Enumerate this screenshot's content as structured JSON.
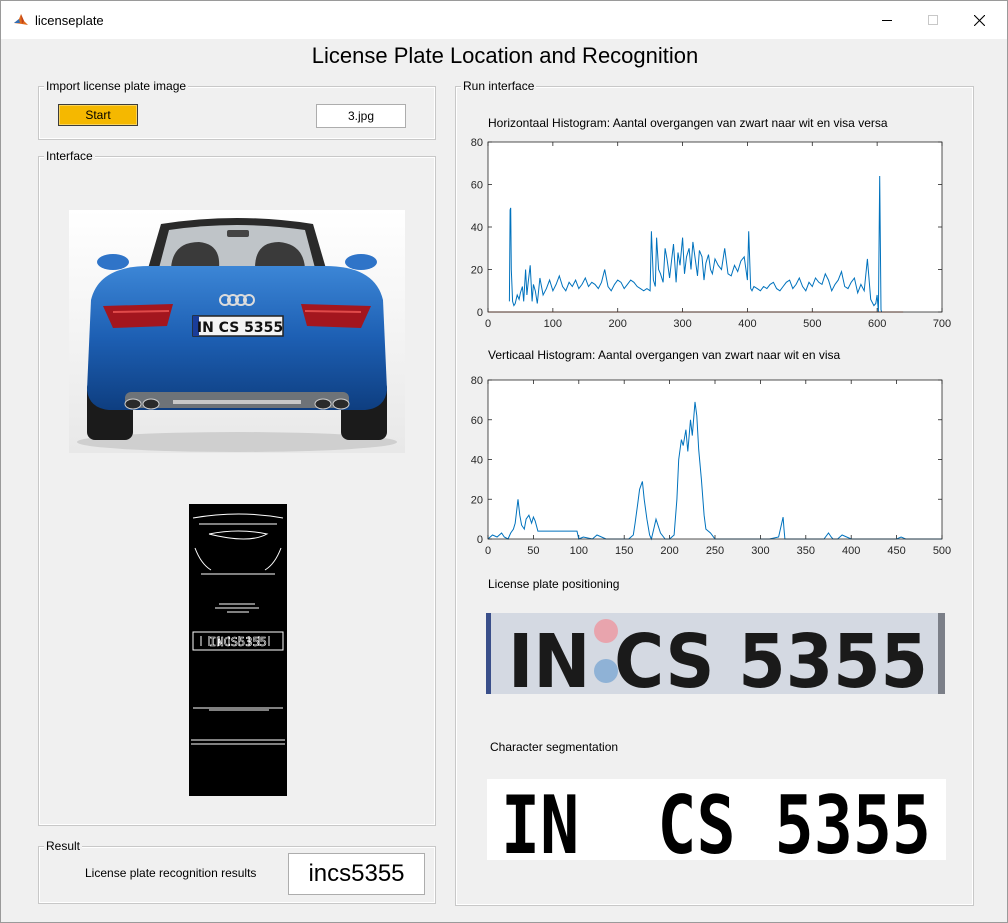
{
  "window": {
    "title": "licenseplate",
    "controls": [
      "minimize-icon",
      "maximize-icon",
      "close-icon"
    ]
  },
  "app_title": "License Plate Location and Recognition",
  "import_panel": {
    "legend": "Import license plate image",
    "start_label": "Start",
    "filename": "3.jpg"
  },
  "interface_panel": {
    "legend": "Interface",
    "car_plate_text": "IN CS 5355",
    "edge_plate_text": "INCS5355"
  },
  "result_panel": {
    "legend": "Result",
    "label": "License plate recognition results",
    "value": "incs5355"
  },
  "run_panel": {
    "legend": "Run interface",
    "plate_positioning_title": "License plate positioning",
    "plate_crop_text": "IN CS 5355",
    "segmentation_title": "Character segmentation",
    "segmentation_text": "IN  CS 5355"
  },
  "chart_data": [
    {
      "type": "line",
      "title": "Horizontaal Histogram: Aantal overgangen van zwart naar wit en visa versa",
      "xlim": [
        0,
        700
      ],
      "ylim": [
        0,
        80
      ],
      "xticks": [
        0,
        100,
        200,
        300,
        400,
        500,
        600,
        700
      ],
      "yticks": [
        0,
        20,
        40,
        60,
        80
      ],
      "series": [
        {
          "color": "#0072bd",
          "x": [
            33,
            34,
            35,
            36,
            38,
            40,
            42,
            45,
            48,
            50,
            53,
            55,
            58,
            60,
            62,
            65,
            68,
            70,
            73,
            76,
            80,
            85,
            90,
            95,
            100,
            105,
            110,
            115,
            120,
            125,
            130,
            135,
            140,
            145,
            150,
            155,
            160,
            165,
            170,
            175,
            180,
            185,
            190,
            195,
            200,
            205,
            210,
            215,
            220,
            225,
            230,
            235,
            240,
            245,
            250,
            252,
            255,
            258,
            260,
            263,
            266,
            270,
            273,
            276,
            280,
            283,
            286,
            290,
            293,
            296,
            300,
            303,
            306,
            310,
            313,
            316,
            320,
            323,
            326,
            330,
            333,
            336,
            340,
            343,
            346,
            350,
            355,
            360,
            365,
            370,
            375,
            380,
            385,
            390,
            395,
            400,
            402,
            405,
            407,
            410,
            415,
            420,
            425,
            430,
            435,
            440,
            445,
            450,
            455,
            460,
            465,
            470,
            475,
            480,
            485,
            490,
            495,
            500,
            505,
            510,
            515,
            520,
            525,
            530,
            535,
            540,
            545,
            550,
            555,
            560,
            565,
            570,
            575,
            580,
            585,
            590,
            595,
            598,
            600,
            602,
            604,
            605,
            606,
            607,
            610,
            620,
            640
          ],
          "y": [
            5,
            48,
            49,
            20,
            5,
            3,
            4,
            8,
            6,
            9,
            12,
            5,
            20,
            8,
            14,
            22,
            5,
            13,
            10,
            4,
            16,
            8,
            11,
            15,
            10,
            13,
            17,
            12,
            10,
            14,
            12,
            15,
            11,
            13,
            16,
            12,
            14,
            13,
            11,
            14,
            20,
            12,
            10,
            13,
            15,
            14,
            11,
            13,
            15,
            14,
            12,
            11,
            10,
            11,
            10,
            38,
            15,
            12,
            35,
            20,
            18,
            14,
            30,
            25,
            16,
            24,
            32,
            14,
            28,
            22,
            35,
            18,
            26,
            30,
            20,
            33,
            24,
            17,
            29,
            26,
            15,
            23,
            27,
            20,
            18,
            25,
            22,
            20,
            30,
            18,
            17,
            22,
            19,
            24,
            26,
            15,
            38,
            11,
            10,
            12,
            11,
            10,
            12,
            11,
            13,
            14,
            11,
            10,
            12,
            14,
            15,
            11,
            13,
            16,
            12,
            10,
            14,
            12,
            16,
            14,
            13,
            18,
            15,
            10,
            13,
            15,
            19,
            12,
            11,
            14,
            16,
            9,
            13,
            10,
            25,
            6,
            3,
            4,
            8,
            0,
            64,
            30,
            1,
            0,
            0,
            0,
            0
          ],
          "description": "blue transitions curve"
        },
        {
          "color": "#d95319",
          "x": [
            0,
            640
          ],
          "y": [
            0,
            0
          ]
        }
      ]
    },
    {
      "type": "line",
      "title": "Verticaal Histogram: Aantal overgangen van zwart naar wit en visa",
      "xlim": [
        0,
        500
      ],
      "ylim": [
        0,
        80
      ],
      "xticks": [
        0,
        50,
        100,
        150,
        200,
        250,
        300,
        350,
        400,
        450,
        500
      ],
      "yticks": [
        0,
        20,
        40,
        60,
        80
      ],
      "series": [
        {
          "color": "#0072bd",
          "x": [
            0,
            5,
            10,
            15,
            18,
            22,
            25,
            28,
            30,
            33,
            35,
            37,
            40,
            42,
            45,
            48,
            50,
            52,
            55,
            60,
            70,
            80,
            90,
            98,
            100,
            105,
            115,
            120,
            130,
            140,
            150,
            155,
            160,
            162,
            165,
            167,
            170,
            172,
            175,
            178,
            180,
            183,
            185,
            190,
            195,
            200,
            205,
            208,
            210,
            213,
            215,
            218,
            220,
            223,
            225,
            228,
            230,
            232,
            235,
            238,
            240,
            245,
            250,
            260,
            270,
            280,
            290,
            300,
            310,
            320,
            325,
            326,
            327,
            330,
            335,
            340,
            350,
            360,
            370,
            375,
            378,
            380,
            385,
            390,
            400,
            420,
            440,
            450,
            455,
            460,
            470,
            480,
            490,
            500
          ],
          "y": [
            0,
            2,
            1,
            3,
            1,
            0,
            3,
            5,
            8,
            20,
            12,
            7,
            5,
            10,
            12,
            8,
            11,
            9,
            4,
            4,
            4,
            4,
            4,
            4,
            0,
            1,
            0,
            2,
            0,
            0,
            0,
            0,
            2,
            8,
            18,
            25,
            29,
            20,
            10,
            2,
            0,
            6,
            10,
            3,
            0,
            0,
            2,
            20,
            40,
            50,
            47,
            55,
            44,
            60,
            52,
            69,
            62,
            45,
            30,
            12,
            5,
            3,
            0,
            0,
            0,
            0,
            0,
            0,
            0,
            1,
            11,
            5,
            0,
            0,
            0,
            0,
            0,
            0,
            0,
            3,
            1,
            0,
            0,
            2,
            0,
            0,
            0,
            0,
            1,
            0,
            0,
            0,
            0,
            0
          ],
          "description": "blue transitions curve"
        }
      ]
    }
  ]
}
